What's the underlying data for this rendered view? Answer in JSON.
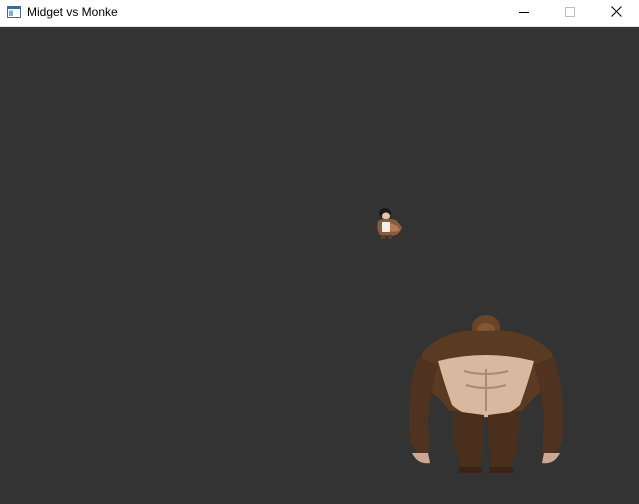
{
  "window": {
    "title": "Midget vs Monke",
    "icon": "app-window-icon",
    "controls": [
      "minimize-icon",
      "maximize-icon",
      "close-icon"
    ]
  },
  "game": {
    "background_color": "#333333",
    "sprites": [
      {
        "name": "midget-sprite",
        "description_color": "#8a5a3c"
      },
      {
        "name": "monke-sprite",
        "fur_color": "#5b3a22",
        "skin_color": "#d8b9a0"
      }
    ]
  }
}
